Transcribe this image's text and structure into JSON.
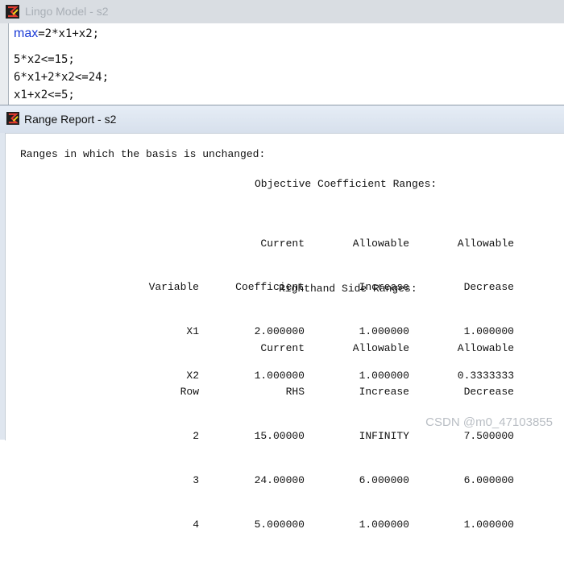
{
  "model_window": {
    "title": "Lingo Model - s2",
    "code_lines": [
      {
        "keyword": "max",
        "rest": "=2*x1+x2;"
      },
      {
        "text": "5*x2<=15;"
      },
      {
        "text": "6*x1+2*x2<=24;"
      },
      {
        "text": "x1+x2<=5;"
      }
    ]
  },
  "report_window": {
    "title": "Range Report - s2",
    "intro": "Ranges in which the basis is unchanged:",
    "objective": {
      "heading": "Objective Coefficient Ranges:",
      "headers": {
        "col1": "Variable",
        "col2_top": "Current",
        "col2": "Coefficient",
        "col3_top": "Allowable",
        "col3": "Increase",
        "col4_top": "Allowable",
        "col4": "Decrease"
      },
      "rows": [
        {
          "name": "X1",
          "current": "2.000000",
          "increase": "1.000000",
          "decrease": "1.000000"
        },
        {
          "name": "X2",
          "current": "1.000000",
          "increase": "1.000000",
          "decrease": "0.3333333"
        }
      ]
    },
    "rhs": {
      "heading": "Righthand Side Ranges:",
      "headers": {
        "col1": "Row",
        "col2_top": "Current",
        "col2": "RHS",
        "col3_top": "Allowable",
        "col3": "Increase",
        "col4_top": "Allowable",
        "col4": "Decrease"
      },
      "rows": [
        {
          "name": "2",
          "current": "15.00000",
          "increase": "INFINITY",
          "decrease": "7.500000"
        },
        {
          "name": "3",
          "current": "24.00000",
          "increase": "6.000000",
          "decrease": "6.000000"
        },
        {
          "name": "4",
          "current": "5.000000",
          "increase": "1.000000",
          "decrease": "1.000000"
        }
      ]
    }
  },
  "watermark": "CSDN @m0_47103855",
  "colors": {
    "keyword": "#1a3ad6",
    "active_titlebar": "#dbe3ee",
    "inactive_title_text": "#a9afb6"
  },
  "icons": {
    "app": "lingo-app-icon"
  }
}
